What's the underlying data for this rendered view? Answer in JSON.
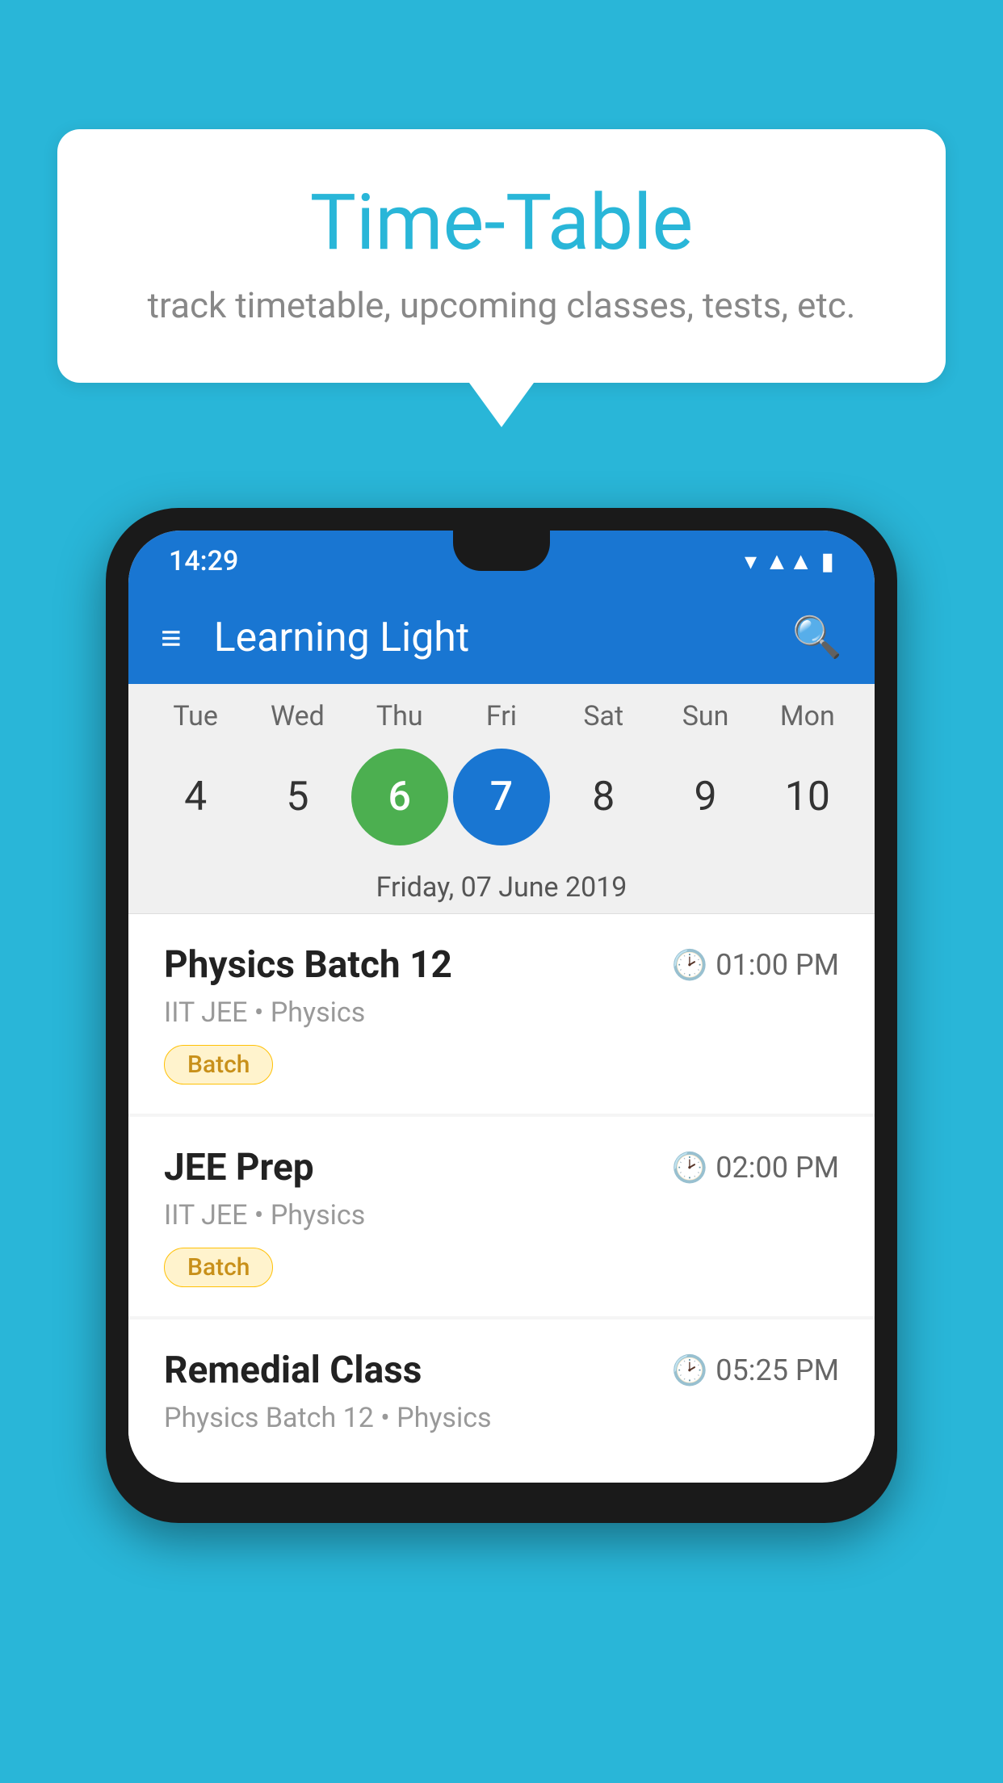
{
  "page": {
    "background_color": "#29b6d8"
  },
  "speech_bubble": {
    "title": "Time-Table",
    "subtitle": "track timetable, upcoming classes, tests, etc."
  },
  "phone": {
    "status_bar": {
      "time": "14:29",
      "icons": [
        "wifi",
        "signal",
        "battery"
      ]
    },
    "app_bar": {
      "title": "Learning Light",
      "menu_icon": "≡",
      "search_icon": "🔍"
    },
    "calendar": {
      "days": [
        "Tue",
        "Wed",
        "Thu",
        "Fri",
        "Sat",
        "Sun",
        "Mon"
      ],
      "dates": [
        "4",
        "5",
        "6",
        "7",
        "8",
        "9",
        "10"
      ],
      "today_index": 2,
      "selected_index": 3,
      "selected_date_label": "Friday, 07 June 2019"
    },
    "schedule_items": [
      {
        "title": "Physics Batch 12",
        "time": "01:00 PM",
        "subtitle": "IIT JEE • Physics",
        "tag": "Batch"
      },
      {
        "title": "JEE Prep",
        "time": "02:00 PM",
        "subtitle": "IIT JEE • Physics",
        "tag": "Batch"
      },
      {
        "title": "Remedial Class",
        "time": "05:25 PM",
        "subtitle": "Physics Batch 12 • Physics",
        "tag": null
      }
    ]
  }
}
